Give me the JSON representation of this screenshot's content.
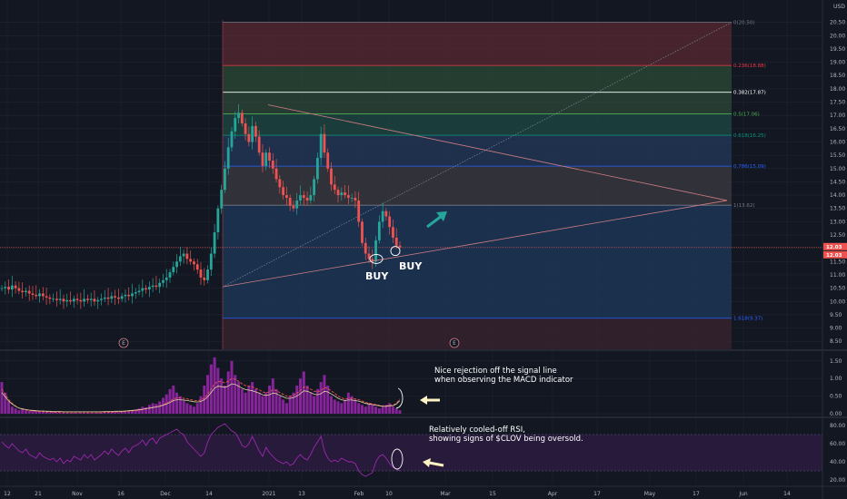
{
  "chart_data": {
    "type": "candlestick",
    "price_axis": {
      "unit_label": "USD",
      "ticks": [
        "20.50",
        "20.00",
        "19.50",
        "19.00",
        "18.50",
        "18.00",
        "17.50",
        "17.00",
        "16.50",
        "16.00",
        "15.50",
        "15.00",
        "14.50",
        "14.00",
        "13.50",
        "13.00",
        "12.50",
        "12.00",
        "11.50",
        "11.00",
        "10.50",
        "10.00",
        "9.50",
        "9.00",
        "8.50"
      ],
      "range": [
        8.2,
        21.0
      ],
      "current_price_tags": [
        "12.03",
        "12.03"
      ]
    },
    "time_axis": {
      "ticks": [
        "12",
        "21",
        "Nov",
        "16",
        "Dec",
        "14",
        "2021",
        "13",
        "Feb",
        "10",
        "Mar",
        "15",
        "Apr",
        "17",
        "May",
        "17",
        "Jun",
        "14"
      ]
    },
    "fib_levels": [
      {
        "label": "0(20.50)",
        "value": 20.5,
        "color": "#787b86"
      },
      {
        "label": "0.236(18.88)",
        "value": 18.88,
        "color": "#f23645"
      },
      {
        "label": "0.382(17.87)",
        "value": 17.87,
        "color": "#ffffff"
      },
      {
        "label": "0.5(17.06)",
        "value": 17.06,
        "color": "#4caf50"
      },
      {
        "label": "0.618(16.25)",
        "value": 16.25,
        "color": "#089981"
      },
      {
        "label": "0.786(15.09)",
        "value": 15.09,
        "color": "#2962ff"
      },
      {
        "label": "1(13.62)",
        "value": 13.62,
        "color": "#787b86"
      },
      {
        "label": "1.618(9.37)",
        "value": 9.37,
        "color": "#2962ff"
      }
    ],
    "candles_close": [
      10.5,
      10.55,
      10.45,
      10.6,
      10.5,
      10.4,
      10.35,
      10.4,
      10.3,
      10.25,
      10.2,
      10.3,
      10.2,
      10.15,
      10.1,
      10.1,
      10.05,
      10.1,
      10.0,
      10.05,
      10.0,
      10.1,
      10.05,
      10.0,
      10.1,
      10.05,
      10.1,
      10.0,
      10.05,
      10.1,
      10.15,
      10.1,
      10.2,
      10.15,
      10.1,
      10.2,
      10.25,
      10.2,
      10.3,
      10.35,
      10.4,
      10.5,
      10.45,
      10.55,
      10.6,
      10.55,
      10.7,
      10.8,
      10.9,
      11.1,
      11.3,
      11.5,
      11.7,
      11.8,
      11.6,
      11.5,
      11.4,
      11.2,
      10.9,
      10.8,
      11.2,
      11.8,
      12.6,
      13.5,
      14.2,
      15.0,
      15.8,
      16.4,
      16.9,
      17.1,
      16.7,
      16.3,
      16.0,
      16.6,
      16.2,
      15.6,
      15.1,
      15.6,
      15.3,
      15.0,
      14.6,
      14.3,
      14.0,
      13.9,
      13.6,
      13.5,
      13.8,
      14.0,
      13.9,
      13.8,
      14.0,
      14.6,
      15.4,
      16.3,
      15.6,
      15.0,
      14.4,
      14.2,
      14.0,
      14.1,
      14.0,
      13.9,
      13.9,
      13.8,
      13.0,
      12.2,
      11.8,
      11.6,
      11.5,
      12.3,
      13.0,
      13.4,
      13.2,
      12.8,
      12.4,
      12.1,
      12.03
    ],
    "candle_start_date": "2020-10-12",
    "macd_axis": {
      "ticks": [
        "1.50",
        "1.00",
        "0.50",
        "0.00"
      ],
      "range": [
        -0.05,
        1.7
      ]
    },
    "macd_histogram": [
      0.9,
      0.6,
      0.35,
      0.2,
      0.15,
      0.1,
      0.15,
      0.1,
      0.08,
      0.1,
      0.08,
      0.06,
      0.08,
      0.05,
      0.04,
      0.05,
      0.04,
      0.03,
      0.04,
      0.03,
      0.02,
      0.03,
      0.02,
      0.03,
      0.02,
      0.03,
      0.02,
      0.02,
      0.03,
      0.04,
      0.05,
      0.04,
      0.06,
      0.05,
      0.04,
      0.06,
      0.08,
      0.07,
      0.1,
      0.12,
      0.15,
      0.2,
      0.18,
      0.25,
      0.3,
      0.28,
      0.35,
      0.45,
      0.55,
      0.7,
      0.8,
      0.6,
      0.5,
      0.4,
      0.3,
      0.25,
      0.2,
      0.3,
      0.5,
      0.8,
      1.1,
      1.4,
      1.6,
      1.3,
      1.0,
      0.8,
      1.2,
      1.5,
      1.1,
      0.9,
      0.7,
      0.6,
      0.8,
      0.9,
      0.7,
      0.6,
      0.5,
      0.6,
      0.8,
      1.0,
      0.7,
      0.5,
      0.4,
      0.3,
      0.5,
      0.6,
      0.8,
      1.0,
      1.2,
      0.8,
      0.6,
      0.5,
      0.7,
      0.9,
      1.1,
      0.8,
      0.5,
      0.4,
      0.35,
      0.3,
      0.4,
      0.6,
      0.5,
      0.4,
      0.3,
      0.25,
      0.2,
      0.3,
      0.25,
      0.2,
      0.15,
      0.2,
      0.25,
      0.3,
      0.2,
      0.15,
      0.1
    ],
    "macd_signal": [
      0.7,
      0.55,
      0.4,
      0.3,
      0.22,
      0.16,
      0.13,
      0.11,
      0.09,
      0.08,
      0.07,
      0.06,
      0.06,
      0.05,
      0.05,
      0.04,
      0.04,
      0.04,
      0.03,
      0.03,
      0.03,
      0.03,
      0.03,
      0.03,
      0.03,
      0.03,
      0.03,
      0.03,
      0.03,
      0.03,
      0.04,
      0.04,
      0.04,
      0.05,
      0.05,
      0.05,
      0.06,
      0.07,
      0.08,
      0.09,
      0.1,
      0.12,
      0.14,
      0.16,
      0.18,
      0.2,
      0.22,
      0.26,
      0.3,
      0.35,
      0.42,
      0.45,
      0.45,
      0.44,
      0.42,
      0.4,
      0.38,
      0.37,
      0.39,
      0.45,
      0.55,
      0.7,
      0.85,
      0.92,
      0.9,
      0.88,
      0.92,
      1.0,
      0.98,
      0.92,
      0.85,
      0.8,
      0.78,
      0.76,
      0.72,
      0.68,
      0.62,
      0.6,
      0.62,
      0.68,
      0.66,
      0.6,
      0.55,
      0.5,
      0.5,
      0.52,
      0.58,
      0.66,
      0.76,
      0.74,
      0.7,
      0.64,
      0.62,
      0.66,
      0.74,
      0.72,
      0.65,
      0.58,
      0.5,
      0.45,
      0.42,
      0.44,
      0.44,
      0.42,
      0.4,
      0.36,
      0.32,
      0.3,
      0.28,
      0.26,
      0.24,
      0.22,
      0.22,
      0.24,
      0.24,
      0.3,
      0.42
    ],
    "rsi_axis": {
      "ticks": [
        "80.00",
        "60.00",
        "40.00",
        "20.00"
      ],
      "range": [
        15,
        85
      ],
      "band": [
        30,
        70
      ]
    },
    "rsi": [
      62,
      58,
      55,
      60,
      56,
      52,
      50,
      54,
      48,
      46,
      44,
      50,
      46,
      44,
      42,
      44,
      40,
      44,
      38,
      42,
      40,
      46,
      44,
      42,
      48,
      44,
      48,
      42,
      45,
      48,
      52,
      48,
      54,
      50,
      47,
      52,
      55,
      50,
      56,
      58,
      60,
      64,
      58,
      64,
      66,
      60,
      66,
      68,
      70,
      72,
      74,
      76,
      72,
      70,
      62,
      58,
      54,
      50,
      46,
      50,
      62,
      70,
      74,
      78,
      80,
      82,
      78,
      74,
      72,
      66,
      58,
      56,
      60,
      68,
      60,
      52,
      46,
      56,
      50,
      46,
      42,
      40,
      38,
      40,
      36,
      38,
      44,
      48,
      44,
      42,
      48,
      56,
      62,
      68,
      52,
      44,
      40,
      42,
      40,
      44,
      42,
      40,
      40,
      38,
      30,
      26,
      24,
      26,
      28,
      40,
      46,
      48,
      44,
      38,
      34,
      32,
      30
    ],
    "annotations": [
      {
        "text": "Nice rejection off the signal line"
      },
      {
        "text": "when observing the MACD indicator"
      },
      {
        "text": "Relatively cooled-off RSI,"
      },
      {
        "text": "showing signs of $CLOV being oversold."
      },
      {
        "text": "BUY"
      },
      {
        "text": "BUY"
      }
    ],
    "earnings_markers": [
      "E",
      "E"
    ]
  },
  "colors": {
    "background": "#131722",
    "grid": "#1f2433",
    "candle_up": "#26a69a",
    "candle_down": "#ef5350",
    "macd_hist": "#9c27b0",
    "macd_signal": "#ef5350",
    "rsi_line": "#9c27b0",
    "rsi_band": "#2a1b3d"
  }
}
